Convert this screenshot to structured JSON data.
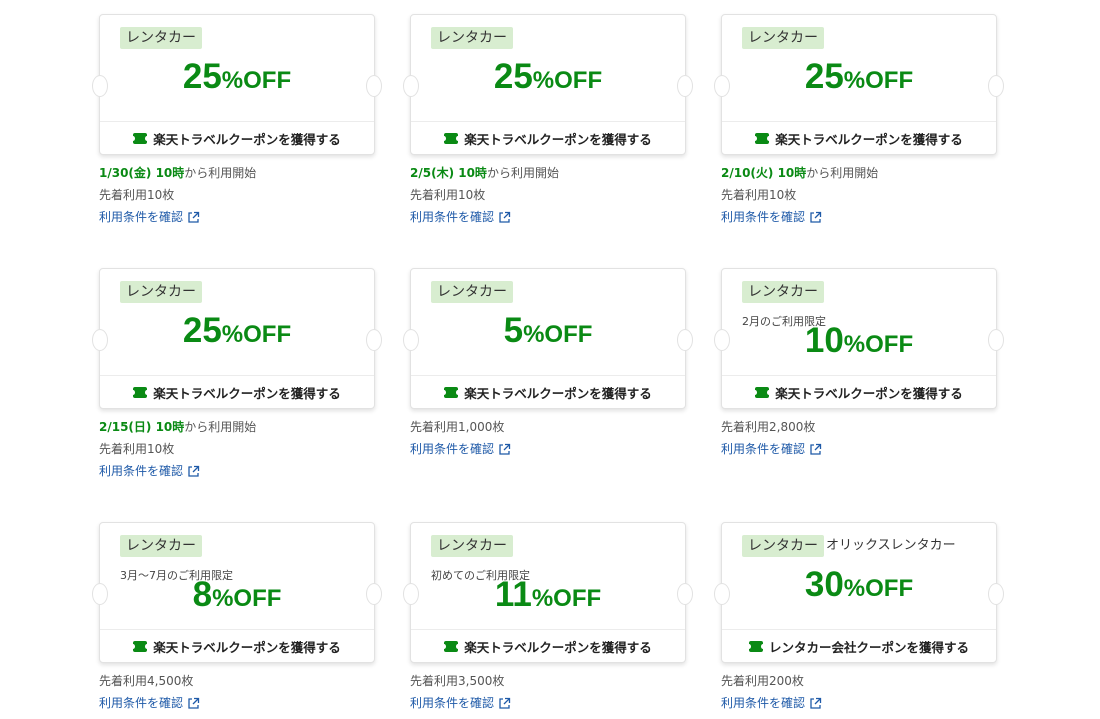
{
  "coupons": [
    {
      "tag": "レンタカー",
      "company": "",
      "condition": "",
      "discount": "25",
      "suffix": "%OFF",
      "button": "楽天トラベルクーポンを獲得する",
      "start_date": "1/30(金) 10時",
      "start_suffix": "から利用開始",
      "stock": "先着利用10枚",
      "link": "利用条件を確認"
    },
    {
      "tag": "レンタカー",
      "company": "",
      "condition": "",
      "discount": "25",
      "suffix": "%OFF",
      "button": "楽天トラベルクーポンを獲得する",
      "start_date": "2/5(木) 10時",
      "start_suffix": "から利用開始",
      "stock": "先着利用10枚",
      "link": "利用条件を確認"
    },
    {
      "tag": "レンタカー",
      "company": "",
      "condition": "",
      "discount": "25",
      "suffix": "%OFF",
      "button": "楽天トラベルクーポンを獲得する",
      "start_date": "2/10(火) 10時",
      "start_suffix": "から利用開始",
      "stock": "先着利用10枚",
      "link": "利用条件を確認"
    },
    {
      "tag": "レンタカー",
      "company": "",
      "condition": "",
      "discount": "25",
      "suffix": "%OFF",
      "button": "楽天トラベルクーポンを獲得する",
      "start_date": "2/15(日) 10時",
      "start_suffix": "から利用開始",
      "stock": "先着利用10枚",
      "link": "利用条件を確認"
    },
    {
      "tag": "レンタカー",
      "company": "",
      "condition": "",
      "discount": "5",
      "suffix": "%OFF",
      "button": "楽天トラベルクーポンを獲得する",
      "start_date": "",
      "start_suffix": "",
      "stock": "先着利用1,000枚",
      "link": "利用条件を確認"
    },
    {
      "tag": "レンタカー",
      "company": "",
      "condition": "2月のご利用限定",
      "discount": "10",
      "suffix": "%OFF",
      "button": "楽天トラベルクーポンを獲得する",
      "start_date": "",
      "start_suffix": "",
      "stock": "先着利用2,800枚",
      "link": "利用条件を確認"
    },
    {
      "tag": "レンタカー",
      "company": "",
      "condition": "3月〜7月のご利用限定",
      "discount": "8",
      "suffix": "%OFF",
      "button": "楽天トラベルクーポンを獲得する",
      "start_date": "",
      "start_suffix": "",
      "stock": "先着利用4,500枚",
      "link": "利用条件を確認"
    },
    {
      "tag": "レンタカー",
      "company": "",
      "condition": "初めてのご利用限定",
      "discount": "11",
      "suffix": "%OFF",
      "button": "楽天トラベルクーポンを獲得する",
      "start_date": "",
      "start_suffix": "",
      "stock": "先着利用3,500枚",
      "link": "利用条件を確認"
    },
    {
      "tag": "レンタカー",
      "company": "オリックスレンタカー",
      "condition": "",
      "discount": "30",
      "suffix": "%OFF",
      "button": "レンタカー会社クーポンを獲得する",
      "start_date": "",
      "start_suffix": "",
      "stock": "先着利用200枚",
      "link": "利用条件を確認"
    }
  ],
  "icons": {
    "button": "ticket-icon",
    "link": "external-link-icon"
  },
  "colors": {
    "accent": "#0a8a14",
    "tag_bg": "#d8edd0",
    "link": "#1f5aa8"
  }
}
